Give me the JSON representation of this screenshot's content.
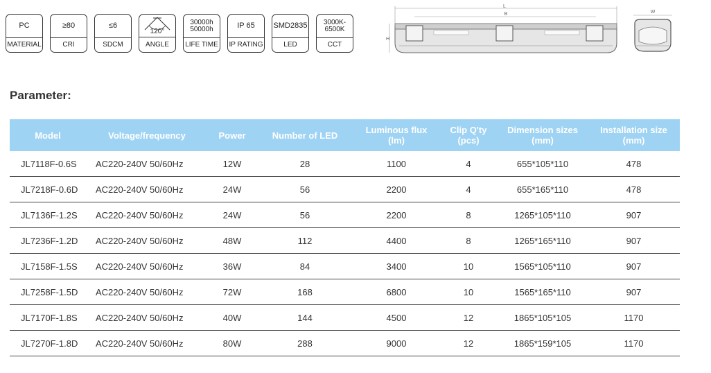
{
  "badges": [
    {
      "top": "PC",
      "bottom": "MATERIAL"
    },
    {
      "top": "≥80",
      "bottom": "CRI"
    },
    {
      "top": "≤6",
      "bottom": "SDCM"
    },
    {
      "top": "120°",
      "bottom": "ANGLE"
    },
    {
      "top": "30000h\n50000h",
      "bottom": "LIFE TIME"
    },
    {
      "top": "IP 65",
      "bottom": "IP RATING"
    },
    {
      "top": "SMD2835",
      "bottom": "LED"
    },
    {
      "top": "3000K-\n6500K",
      "bottom": "CCT"
    }
  ],
  "drawing": {
    "label_L": "L",
    "label_B": "B",
    "label_H": "H",
    "label_W": "W"
  },
  "section_title": "Parameter:",
  "table": {
    "headers": [
      "Model",
      "Voltage/frequency",
      "Power",
      "Number of LED",
      "Luminous flux\n(lm)",
      "Clip Q'ty\n(pcs)",
      "Dimension sizes\n(mm)",
      "Installation size\n(mm)"
    ],
    "rows": [
      [
        "JL7118F-0.6S",
        "AC220-240V 50/60Hz",
        "12W",
        "28",
        "1100",
        "4",
        "655*105*110",
        "478"
      ],
      [
        "JL7218F-0.6D",
        "AC220-240V 50/60Hz",
        "24W",
        "56",
        "2200",
        "4",
        "655*165*110",
        "478"
      ],
      [
        "JL7136F-1.2S",
        "AC220-240V 50/60Hz",
        "24W",
        "56",
        "2200",
        "8",
        "1265*105*110",
        "907"
      ],
      [
        "JL7236F-1.2D",
        "AC220-240V 50/60Hz",
        "48W",
        "112",
        "4400",
        "8",
        "1265*165*110",
        "907"
      ],
      [
        "JL7158F-1.5S",
        "AC220-240V 50/60Hz",
        "36W",
        "84",
        "3400",
        "10",
        "1565*105*110",
        "907"
      ],
      [
        "JL7258F-1.5D",
        "AC220-240V 50/60Hz",
        "72W",
        "168",
        "6800",
        "10",
        "1565*165*110",
        "907"
      ],
      [
        "JL7170F-1.8S",
        "AC220-240V 50/60Hz",
        "40W",
        "144",
        "4500",
        "12",
        "1865*105*105",
        "1170"
      ],
      [
        "JL7270F-1.8D",
        "AC220-240V 50/60Hz",
        "80W",
        "288",
        "9000",
        "12",
        "1865*159*105",
        "1170"
      ]
    ]
  },
  "colors": {
    "header_bg": "#9fd3f3",
    "header_text": "#ffffff"
  }
}
